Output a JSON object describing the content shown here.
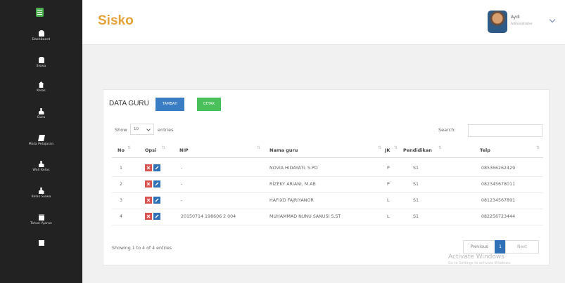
{
  "app": {
    "brand": "Sisko"
  },
  "user": {
    "name": "Aydi",
    "role": "Administrator"
  },
  "sidebar": {
    "items": [
      {
        "label": "Dashboard",
        "icon": "dashboard-icon"
      },
      {
        "label": "Siswa",
        "icon": "users-icon"
      },
      {
        "label": "Kelas",
        "icon": "home-icon"
      },
      {
        "label": "Guru",
        "icon": "user-icon"
      },
      {
        "label": "Mata Pelajaran",
        "icon": "book-icon"
      },
      {
        "label": "Wali Kelas",
        "icon": "user-icon"
      },
      {
        "label": "Kelas Siswa",
        "icon": "user-icon"
      },
      {
        "label": "Tahun Ajaran",
        "icon": "calendar-icon"
      }
    ]
  },
  "card": {
    "title": "DATA GURU",
    "tambah_label": "TAMBAH",
    "cetak_label": "CETAK"
  },
  "controls": {
    "show_label": "Show",
    "length_value": "10",
    "entries_label": "entries",
    "search_label": "Search:",
    "search_value": ""
  },
  "table": {
    "columns": [
      "No",
      "Opsi",
      "NIP",
      "Nama guru",
      "JK",
      "Pendidikan",
      "Telp"
    ],
    "rows": [
      {
        "no": "1",
        "nip": "-",
        "nama": "NOVIA HIDAYATI, S.PD",
        "jk": "P",
        "pendidikan": "S1",
        "telp": "085366262429"
      },
      {
        "no": "2",
        "nip": "-",
        "nama": "RIZEKY ARIANI, M.AB",
        "jk": "P",
        "pendidikan": "S1",
        "telp": "082345678011"
      },
      {
        "no": "3",
        "nip": "-",
        "nama": "HAFIXD FAJRIYANOR",
        "jk": "L",
        "pendidikan": "S1",
        "telp": "081234567891"
      },
      {
        "no": "4",
        "nip": "20150714 198606 2 004",
        "nama": "MUHAMMAD NUNU SANUSI S.ST",
        "jk": "L",
        "pendidikan": "S1",
        "telp": "082256723444"
      }
    ]
  },
  "footer": {
    "info": "Showing 1 to 4 of 4 entries",
    "prev_label": "Previous",
    "page_label": "1",
    "next_label": "Next"
  },
  "watermark": {
    "title": "Activate Windows",
    "subtitle": "Go to Settings to activate Windows."
  },
  "colors": {
    "accent": "#e4a23a",
    "sidebar": "#222222",
    "primary": "#3b7dc4",
    "success": "#49c05a",
    "danger": "#d9534f"
  }
}
